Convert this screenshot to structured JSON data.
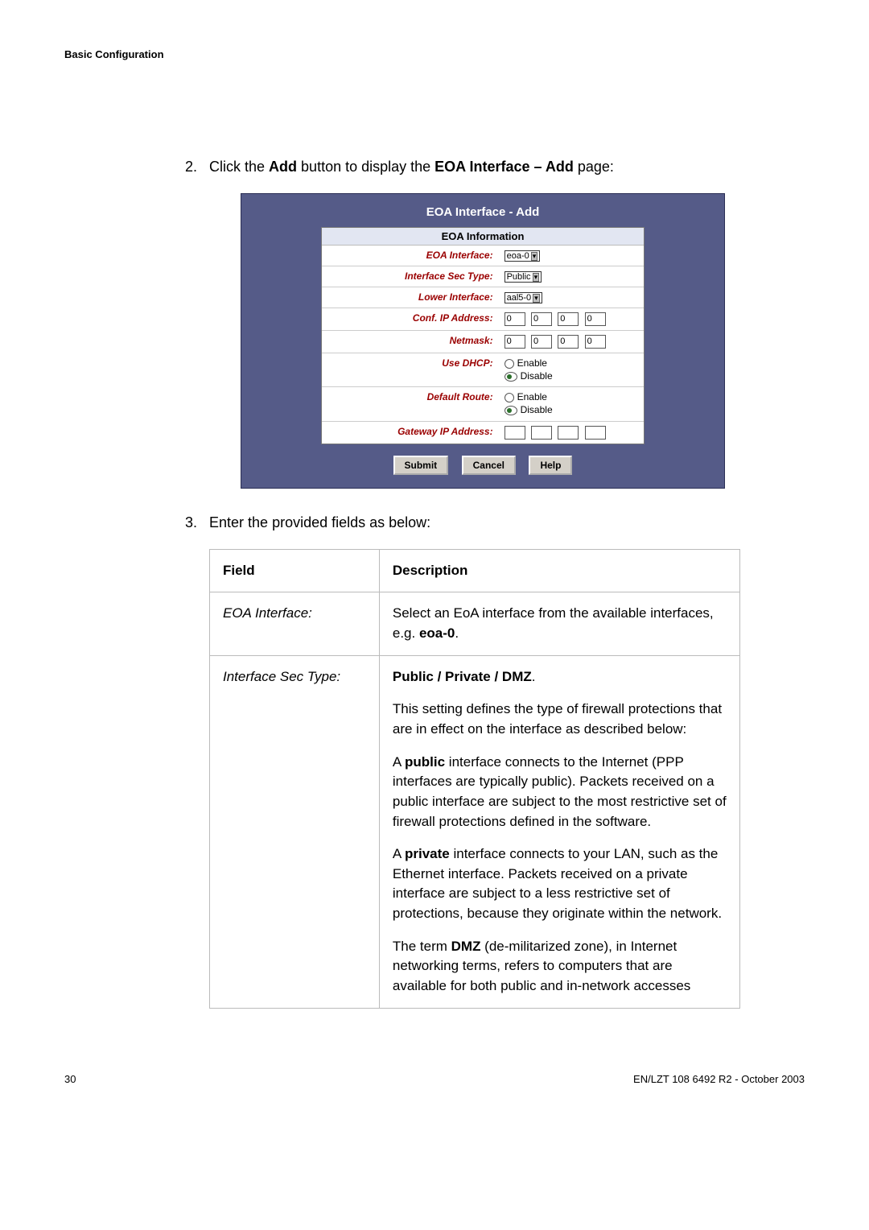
{
  "header": {
    "section": "Basic Configuration"
  },
  "steps": {
    "s2_prefix": "2.",
    "s2_a": "Click the ",
    "s2_b": "Add",
    "s2_c": " button to display the ",
    "s2_d": "EOA Interface – Add",
    "s2_e": " page:",
    "s3_prefix": "3.",
    "s3_text": "Enter the provided fields as below:"
  },
  "eoa": {
    "title": "EOA Interface - Add",
    "info_head": "EOA Information",
    "labels": {
      "eoa_if": "EOA Interface:",
      "if_sec_type": "Interface Sec Type:",
      "lower_if": "Lower Interface:",
      "conf_ip": "Conf. IP Address:",
      "netmask": "Netmask:",
      "use_dhcp": "Use DHCP:",
      "default_route": "Default Route:",
      "gw_ip": "Gateway IP Address:"
    },
    "values": {
      "eoa_if": "eoa-0",
      "if_sec_type": "Public",
      "lower_if": "aal5-0",
      "conf_ip": [
        "0",
        "0",
        "0",
        "0"
      ],
      "netmask": [
        "0",
        "0",
        "0",
        "0"
      ],
      "gw_ip": [
        "",
        "",
        "",
        ""
      ],
      "enable_label": "Enable",
      "disable_label": "Disable",
      "use_dhcp_sel": "Disable",
      "default_route_sel": "Disable"
    },
    "buttons": {
      "submit": "Submit",
      "cancel": "Cancel",
      "help": "Help"
    }
  },
  "table": {
    "head_field": "Field",
    "head_desc": "Description",
    "row1": {
      "field": "EOA Interface:",
      "d1a": "Select an EoA interface from the available interfaces, e.g. ",
      "d1b": "eoa-0",
      "d1c": "."
    },
    "row2": {
      "field": "Interface Sec Type:",
      "p1a": "Public / Private / DMZ",
      "p1b": ".",
      "p2": "This setting defines the type of firewall protections that are in effect on the interface as described below:",
      "p3a": "A ",
      "p3b": "public",
      "p3c": " interface connects to the Internet (PPP interfaces are typically public). Packets received on a public interface are subject to the most restrictive set of firewall protections defined in the software.",
      "p4a": "A ",
      "p4b": "private",
      "p4c": " interface connects to your LAN, such as the Ethernet interface. Packets received on a private interface are subject to a less restrictive set of protections, because they originate within the network.",
      "p5a": "The term ",
      "p5b": "DMZ",
      "p5c": " (de-militarized zone), in Internet networking terms, refers to computers that are available for both public and in-network accesses"
    }
  },
  "footer": {
    "page": "30",
    "right": "EN/LZT 108 6492 R2  - October 2003"
  }
}
